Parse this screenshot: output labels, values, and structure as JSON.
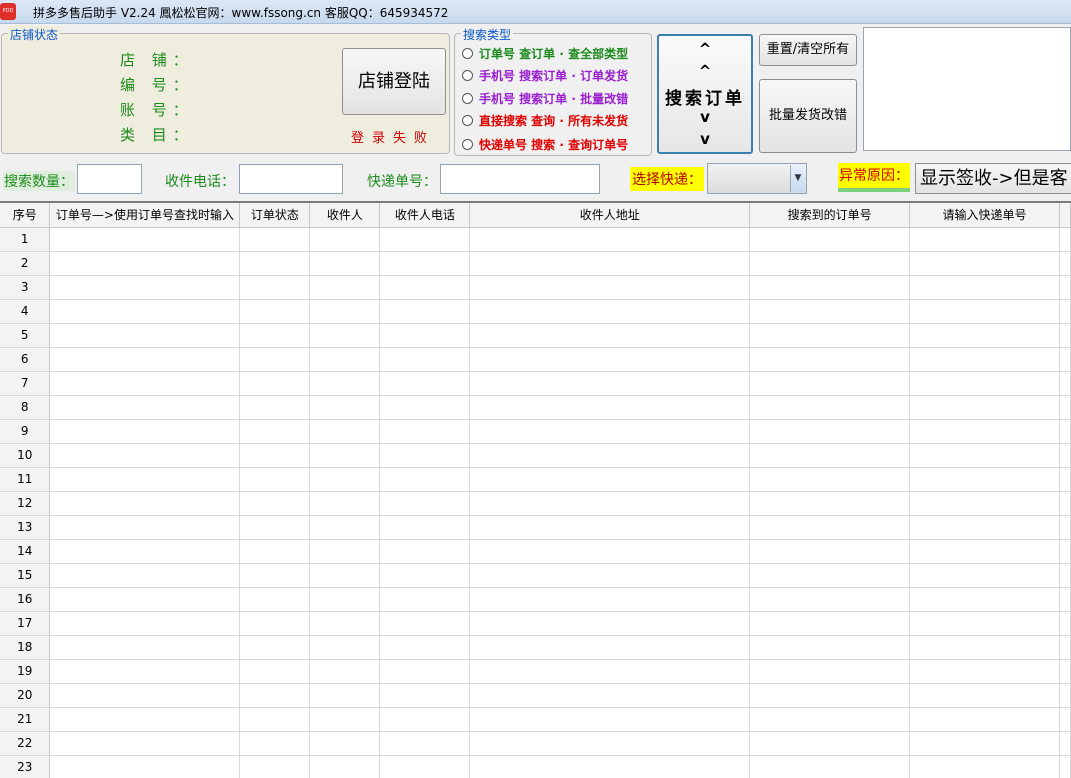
{
  "window": {
    "title": "拼多多售后助手 V2.24   鳳松松官网：www.fssong.cn  客服QQ：645934572",
    "icon": "pinduoduo-app-icon"
  },
  "shop_status": {
    "legend": "店铺状态",
    "labels": [
      "店 铺：",
      "编 号：",
      "账 号：",
      "类 目："
    ],
    "login_button": "店铺登陆",
    "login_status": "登录失败"
  },
  "search_type": {
    "legend": "搜索类型",
    "options": [
      {
        "label": "订单号  查订单 · 查全部类型",
        "color": "green"
      },
      {
        "label": "手机号  搜索订单 · 订单发货",
        "color": "purple"
      },
      {
        "label": "手机号  搜索订单 · 批量改错",
        "color": "purple"
      },
      {
        "label": "直接搜索  查询 · 所有未发货",
        "color": "red"
      },
      {
        "label": "快递单号  搜索 · 查询订单号",
        "color": "red"
      }
    ]
  },
  "search_button": {
    "line1": "^",
    "line2": "^",
    "label": "搜索订单",
    "line4": "v",
    "line5": "v"
  },
  "reset_button": "重置/清空所有",
  "batch_button": "批量发货改错",
  "filters": {
    "search_count_label": "搜索数量：",
    "search_count_value": "",
    "phone_label": "收件电话：",
    "phone_value": "",
    "tracking_label": "快递单号：",
    "tracking_value": "",
    "courier_label": "选择快递：",
    "courier_value": "",
    "reason_label": "异常原因：",
    "reason_value": "显示签收->但是客"
  },
  "grid": {
    "columns": [
      "序号",
      "订单号—>使用订单号查找时输入",
      "订单状态",
      "收件人",
      "收件人电话",
      "收件人地址",
      "搜索到的订单号",
      "请输入快递单号"
    ],
    "row_numbers": [
      "1",
      "2",
      "3",
      "4",
      "5",
      "6",
      "7",
      "8",
      "9",
      "10",
      "11",
      "12",
      "13",
      "14",
      "15",
      "16",
      "17",
      "18",
      "19",
      "20",
      "21",
      "22",
      "23"
    ]
  },
  "colors": {
    "green": "#1c8a1c",
    "purple": "#9a1fd0",
    "red": "#e00000",
    "highlight": "#ffff00"
  }
}
